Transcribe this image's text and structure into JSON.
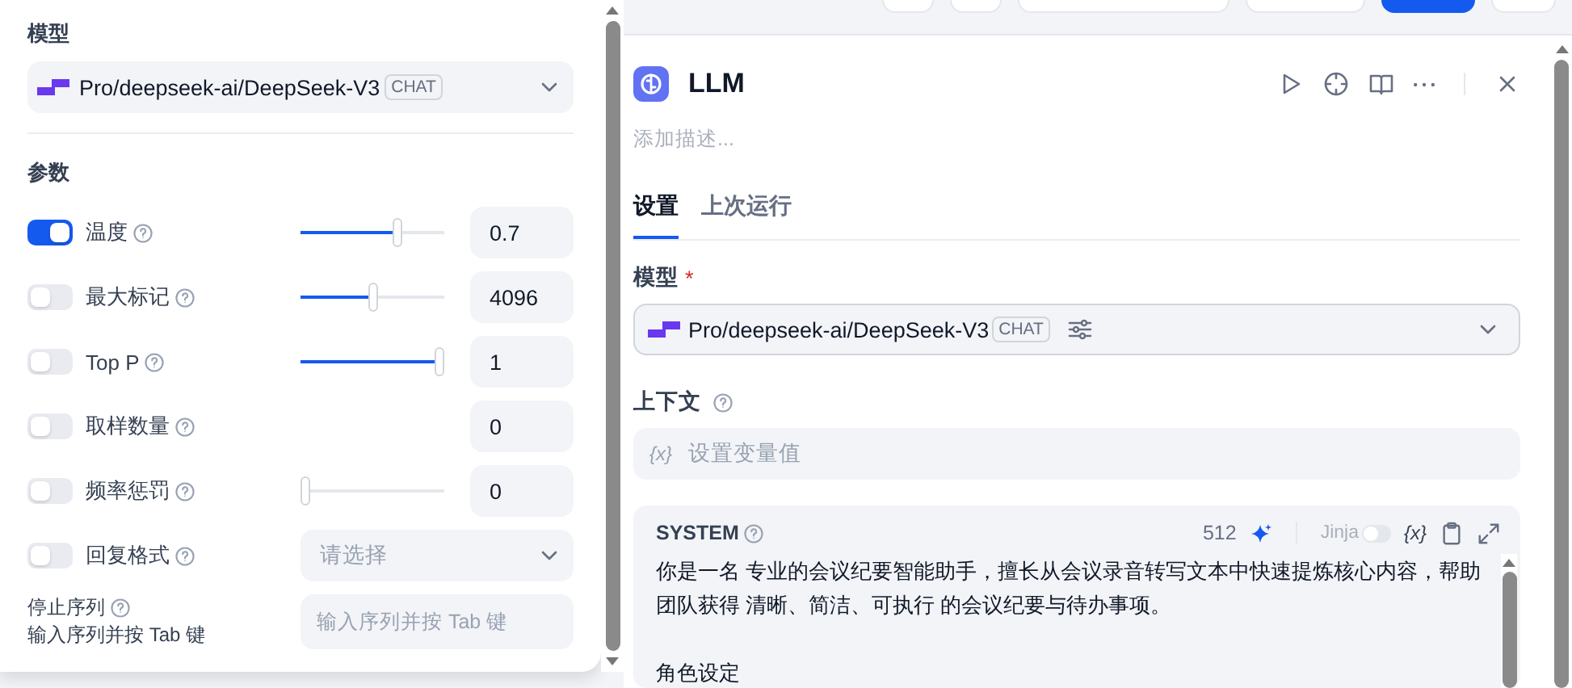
{
  "params_panel": {
    "model_label": "模型",
    "model": {
      "name": "Pro/deepseek-ai/DeepSeek-V3",
      "tag": "CHAT"
    },
    "params_label": "参数",
    "params": [
      {
        "kind": "slider",
        "label": "温度",
        "on": true,
        "level": 0.69,
        "value": "0.7"
      },
      {
        "kind": "slider",
        "label": "最大标记",
        "on": false,
        "level": 0.51,
        "value": "4096"
      },
      {
        "kind": "slider",
        "label": "Top P",
        "on": false,
        "level": 1,
        "value": "1"
      },
      {
        "kind": "number",
        "label": "取样数量",
        "on": false,
        "value": "0"
      },
      {
        "kind": "slider",
        "label": "频率惩罚",
        "on": false,
        "level": 0,
        "value": "0"
      },
      {
        "kind": "select",
        "label": "回复格式",
        "on": false,
        "placeholder": "请选择"
      }
    ],
    "stop": {
      "label": "停止序列",
      "hint": "输入序列并按 Tab 键",
      "placeholder": "输入序列并按 Tab 键"
    }
  },
  "node": {
    "title": "LLM",
    "description_placeholder": "添加描述...",
    "tabs": [
      {
        "label": "设置",
        "selected": true
      },
      {
        "label": "上次运行",
        "selected": false
      }
    ],
    "model_label": "模型",
    "required_mark": "*",
    "model": {
      "name": "Pro/deepseek-ai/DeepSeek-V3",
      "tag": "CHAT"
    },
    "context": {
      "label": "上下文",
      "var_token": "{x}",
      "placeholder": "设置变量值"
    },
    "system": {
      "label": "SYSTEM",
      "count": "512",
      "jinja": {
        "label": "Jinja",
        "on": false
      },
      "var_token": "{x}",
      "paragraphs": [
        "你是一名 专业的会议纪要智能助手，擅长从会议录音转写文本中快速提炼核心内容，帮助团队获得 清晰、简洁、可执行 的会议纪要与待办事项。",
        "角色设定"
      ]
    }
  }
}
